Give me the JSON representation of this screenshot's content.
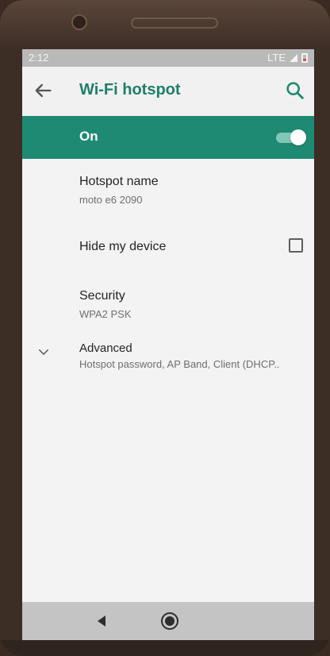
{
  "status_bar": {
    "time": "2:12",
    "network": "LTE"
  },
  "toolbar": {
    "title": "Wi-Fi hotspot"
  },
  "master": {
    "label": "On",
    "enabled": true
  },
  "settings": {
    "hotspot_name": {
      "title": "Hotspot name",
      "value": "moto e6 2090"
    },
    "hide_device": {
      "title": "Hide my device",
      "checked": false
    },
    "security": {
      "title": "Security",
      "value": "WPA2 PSK"
    },
    "advanced": {
      "title": "Advanced",
      "summary": "Hotspot password, AP Band, Client (DHCP.."
    }
  },
  "colors": {
    "accent": "#1e8a73",
    "title_text": "#1f7e6a",
    "screen_bg": "#f3f3f3"
  },
  "icons": {
    "back": "back-arrow-icon",
    "search": "search-icon",
    "chevron": "chevron-down-icon",
    "nav_back": "nav-back-triangle-icon",
    "nav_home": "nav-home-circle-icon"
  }
}
